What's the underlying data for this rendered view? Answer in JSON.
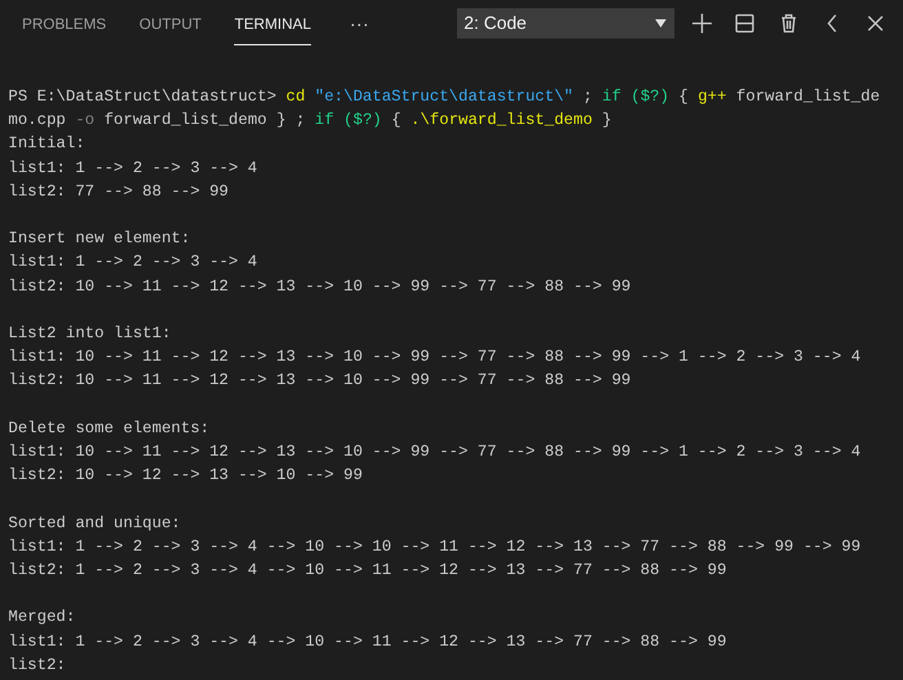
{
  "tabs": [
    {
      "label": "PROBLEMS",
      "selected": false
    },
    {
      "label": "OUTPUT",
      "selected": false
    },
    {
      "label": "TERMINAL",
      "selected": true
    }
  ],
  "more_button": "···",
  "terminal_select": {
    "value": "2: Code"
  },
  "terminal": {
    "prompt": "PS E:\\DataStruct\\datastruct> ",
    "command": [
      {
        "kind": "command",
        "text": "cd"
      },
      {
        "kind": "string",
        "text": " \"e:\\DataStruct\\datastruct\\\""
      },
      {
        "kind": "plain",
        "text": " ; "
      },
      {
        "kind": "keyword",
        "text": "if ($?)"
      },
      {
        "kind": "plain",
        "text": " { "
      },
      {
        "kind": "command",
        "text": "g++"
      },
      {
        "kind": "plain",
        "text": " forward_list_demo.cpp "
      },
      {
        "kind": "parameter",
        "text": "-o"
      },
      {
        "kind": "plain",
        "text": " forward_list_demo } ; "
      },
      {
        "kind": "keyword",
        "text": "if ($?)"
      },
      {
        "kind": "plain",
        "text": " { "
      },
      {
        "kind": "command",
        "text": ".\\forward_list_demo"
      },
      {
        "kind": "plain",
        "text": " }"
      }
    ],
    "blocks": [
      {
        "heading": "Initial:",
        "lines": [
          "list1: 1 --> 2 --> 3 --> 4",
          "list2: 77 --> 88 --> 99"
        ]
      },
      {
        "heading": "Insert new element:",
        "lines": [
          "list1: 1 --> 2 --> 3 --> 4",
          "list2: 10 --> 11 --> 12 --> 13 --> 10 --> 99 --> 77 --> 88 --> 99"
        ]
      },
      {
        "heading": "List2 into list1:",
        "lines": [
          "list1: 10 --> 11 --> 12 --> 13 --> 10 --> 99 --> 77 --> 88 --> 99 --> 1 --> 2 --> 3 --> 4",
          "list2: 10 --> 11 --> 12 --> 13 --> 10 --> 99 --> 77 --> 88 --> 99"
        ]
      },
      {
        "heading": "Delete some elements:",
        "lines": [
          "list1: 10 --> 11 --> 12 --> 13 --> 10 --> 99 --> 77 --> 88 --> 99 --> 1 --> 2 --> 3 --> 4",
          "list2: 10 --> 12 --> 13 --> 10 --> 99"
        ]
      },
      {
        "heading": "Sorted and unique:",
        "lines": [
          "list1: 1 --> 2 --> 3 --> 4 --> 10 --> 10 --> 11 --> 12 --> 13 --> 77 --> 88 --> 99 --> 99",
          "list2: 1 --> 2 --> 3 --> 4 --> 10 --> 11 --> 12 --> 13 --> 77 --> 88 --> 99"
        ]
      },
      {
        "heading": "Merged:",
        "lines": [
          "list1: 1 --> 2 --> 3 --> 4 --> 10 --> 11 --> 12 --> 13 --> 77 --> 88 --> 99",
          "list2:"
        ]
      }
    ]
  }
}
